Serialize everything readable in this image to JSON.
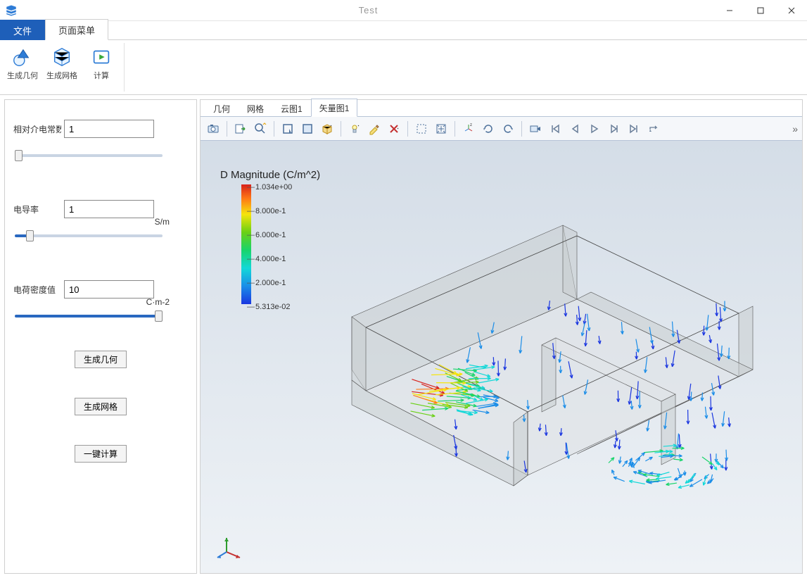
{
  "window": {
    "title": "Test"
  },
  "menu": {
    "file": "文件",
    "pageMenu": "页面菜单"
  },
  "ribbon": {
    "genGeom": "生成几何",
    "genMesh": "生成网格",
    "compute": "计算"
  },
  "params": {
    "relPerm": {
      "label": "相对介电常数",
      "value": "1",
      "unit": ""
    },
    "conductivity": {
      "label": "电导率",
      "value": "1",
      "unit": "S/m"
    },
    "chargeDensity": {
      "label": "电荷密度值",
      "value": "10",
      "unit": "C·m-2"
    }
  },
  "sideButtons": {
    "genGeom": "生成几何",
    "genMesh": "生成网格",
    "compute": "一键计算"
  },
  "viewerTabs": {
    "geom": "几何",
    "mesh": "网格",
    "cloud": "云图1",
    "vector": "矢量图1"
  },
  "plot": {
    "title": "D Magnitude (C/m^2)",
    "legend": {
      "max": "1.034e+00",
      "t1": "8.000e-1",
      "t2": "6.000e-1",
      "t3": "4.000e-1",
      "t4": "2.000e-1",
      "min": "5.313e-02"
    }
  }
}
